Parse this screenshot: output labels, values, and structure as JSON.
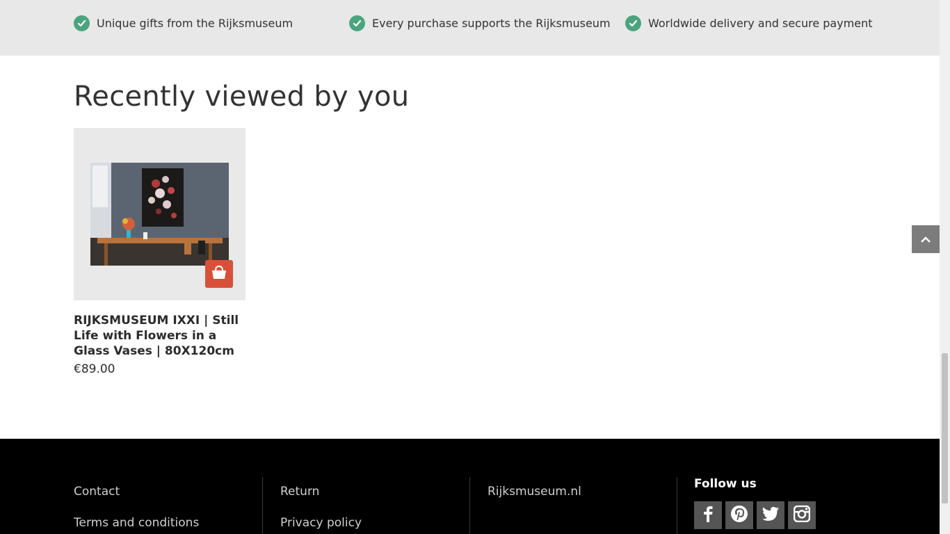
{
  "usps": [
    {
      "text": "Unique gifts from the Rijksmuseum",
      "icon": "check-circle-icon"
    },
    {
      "text": "Every purchase supports the Rijksmuseum",
      "icon": "check-circle-icon"
    },
    {
      "text": "Worldwide delivery and secure payment",
      "icon": "check-circle-icon"
    }
  ],
  "recently_viewed": {
    "title": "Recently viewed by you",
    "products": [
      {
        "title": "RIJKSMUSEUM IXXI | Still Life with Flowers in a Glass Vases | 80X120cm",
        "price": "€89.00",
        "cart_icon": "shopping-bag-icon"
      }
    ]
  },
  "footer": {
    "links_col1": [
      "Contact",
      "Terms and conditions"
    ],
    "links_col2": [
      "Return",
      "Privacy policy"
    ],
    "links_col3": [
      "Rijksmuseum.nl"
    ],
    "follow_title": "Follow us",
    "socials": [
      "facebook-icon",
      "pinterest-icon",
      "twitter-icon",
      "instagram-icon"
    ]
  },
  "colors": {
    "usp_bar": "#e8e8e8",
    "check": "#4aa57e",
    "cart_button": "#d9503a",
    "footer": "#000000",
    "social_button": "#555555"
  }
}
